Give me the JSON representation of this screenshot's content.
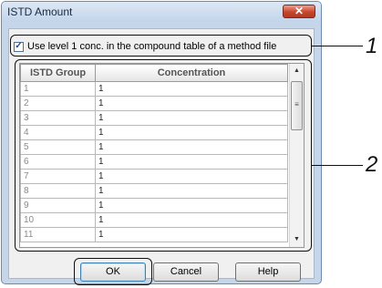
{
  "dialog": {
    "title": "ISTD Amount",
    "close_icon": "close-icon",
    "checkbox": {
      "label": "Use level 1 conc. in the compound table of a method file",
      "checked": true
    },
    "grid": {
      "columns": [
        "ISTD Group",
        "Concentration"
      ],
      "rows": [
        {
          "group": "1",
          "conc": "1"
        },
        {
          "group": "2",
          "conc": "1"
        },
        {
          "group": "3",
          "conc": "1"
        },
        {
          "group": "4",
          "conc": "1"
        },
        {
          "group": "5",
          "conc": "1"
        },
        {
          "group": "6",
          "conc": "1"
        },
        {
          "group": "7",
          "conc": "1"
        },
        {
          "group": "8",
          "conc": "1"
        },
        {
          "group": "9",
          "conc": "1"
        },
        {
          "group": "10",
          "conc": "1"
        },
        {
          "group": "11",
          "conc": "1"
        }
      ]
    },
    "buttons": {
      "ok": "OK",
      "cancel": "Cancel",
      "help": "Help"
    }
  },
  "callouts": {
    "one": "1",
    "two": "2"
  }
}
